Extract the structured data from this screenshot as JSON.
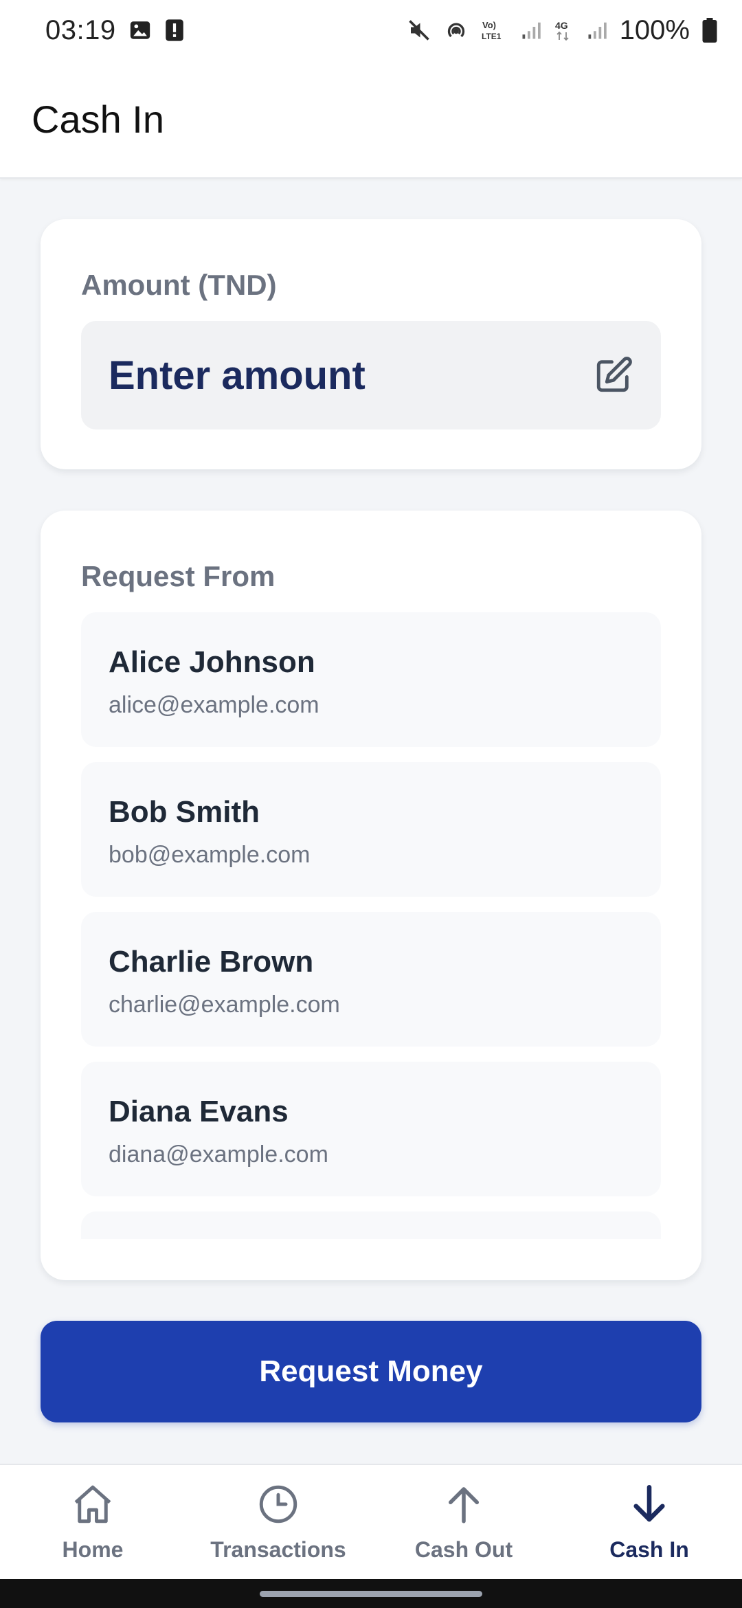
{
  "status_bar": {
    "time": "03:19",
    "battery": "100%",
    "icons": [
      "image-icon",
      "alert-icon",
      "mute-icon",
      "hotspot-icon",
      "volte-icon",
      "signal-icon",
      "4g-icon",
      "signal-icon",
      "battery-icon"
    ]
  },
  "app_bar": {
    "title": "Cash In"
  },
  "amount": {
    "label": "Amount (TND)",
    "placeholder": "Enter amount",
    "icon": "edit-icon"
  },
  "request_from": {
    "label": "Request From",
    "contacts": [
      {
        "name": "Alice Johnson",
        "email": "alice@example.com"
      },
      {
        "name": "Bob Smith",
        "email": "bob@example.com"
      },
      {
        "name": "Charlie Brown",
        "email": "charlie@example.com"
      },
      {
        "name": "Diana Evans",
        "email": "diana@example.com"
      }
    ]
  },
  "actions": {
    "request_money": "Request Money"
  },
  "bottom_nav": {
    "items": [
      {
        "label": "Home",
        "icon": "home-icon",
        "active": false
      },
      {
        "label": "Transactions",
        "icon": "clock-icon",
        "active": false
      },
      {
        "label": "Cash Out",
        "icon": "arrow-up-icon",
        "active": false
      },
      {
        "label": "Cash In",
        "icon": "arrow-down-icon",
        "active": true
      }
    ]
  },
  "colors": {
    "primary": "#1e3faf",
    "navy": "#1b2a5e",
    "muted": "#6b7280",
    "background": "#f3f5f8"
  }
}
